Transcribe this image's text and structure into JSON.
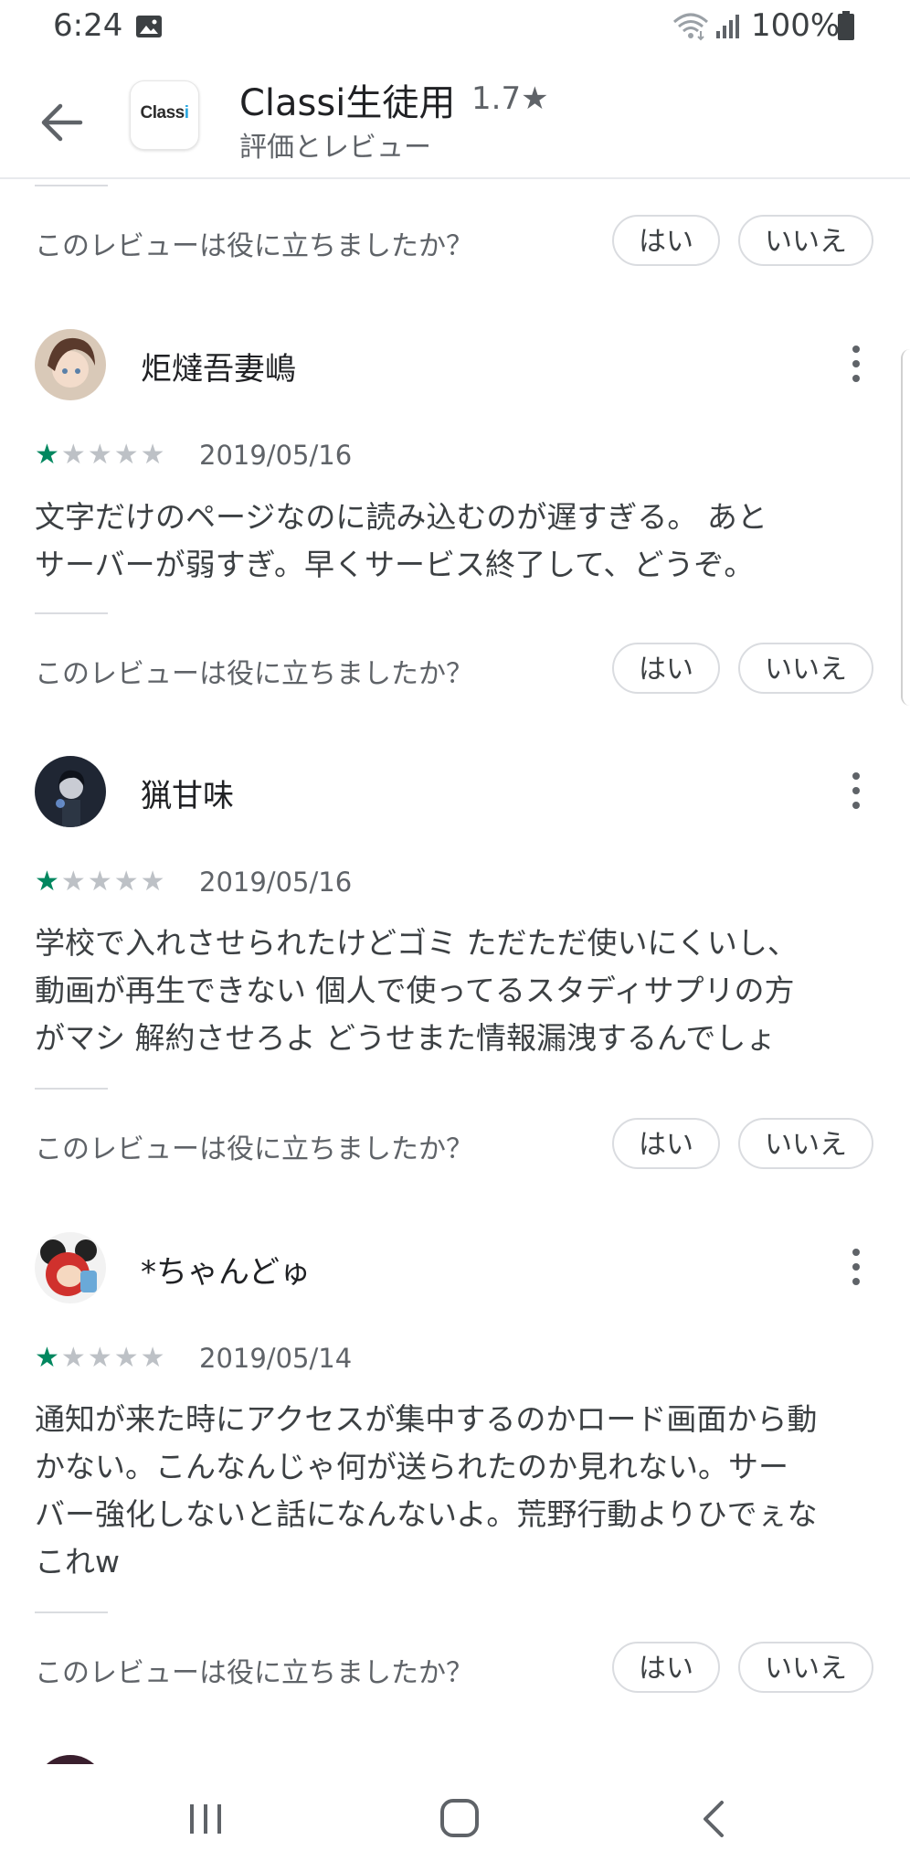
{
  "status_bar": {
    "time": "6:24",
    "battery": "100%",
    "icons": [
      "image-icon",
      "wifi-icon",
      "signal-icon",
      "battery-icon"
    ]
  },
  "header": {
    "app_icon_text": "Classi",
    "title": "Classi生徒用",
    "rating": "1.7★",
    "subtitle": "評価とレビュー"
  },
  "helpful": {
    "question": "このレビューは役に立ちましたか？",
    "yes": "はい",
    "no": "いいえ"
  },
  "reviews": [
    {
      "name": "炬燵吾妻嶋",
      "rating": 1,
      "max_rating": 5,
      "date": "2019/05/16",
      "lines": [
        "文字だけのページなのに読み込むのが遅すぎる。 あと",
        "サーバーが弱すぎ。早くサービス終了して、どうぞ。"
      ]
    },
    {
      "name": "猟甘味",
      "rating": 1,
      "max_rating": 5,
      "date": "2019/05/16",
      "lines": [
        "学校で入れさせられたけどゴミ ただただ使いにくいし、",
        "動画が再生できない 個人で使ってるスタディサプリの方",
        "がマシ 解約させろよ どうせまた情報漏洩するんでしょ"
      ]
    },
    {
      "name": "*ちゃんどゅ",
      "rating": 1,
      "max_rating": 5,
      "date": "2019/05/14",
      "lines": [
        "通知が来た時にアクセスが集中するのかロード画面から動",
        "かない。こんなんじゃ何が送られたのか見れない。サー",
        "バー強化しないと話になんないよ。荒野行動よりひでぇな",
        "これw"
      ]
    }
  ],
  "colors": {
    "star_on": "#01875f",
    "star_off": "#bdc1c6",
    "text_primary": "#202124",
    "text_secondary": "#5f6368"
  }
}
